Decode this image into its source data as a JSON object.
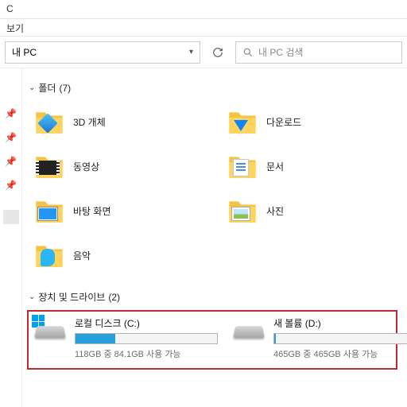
{
  "window": {
    "title": "C"
  },
  "menu": {
    "view": "보기"
  },
  "address": {
    "location": "내 PC"
  },
  "search": {
    "placeholder": "내 PC 검색"
  },
  "groups": {
    "folders": {
      "label": "폴더",
      "count": "(7)"
    },
    "devices": {
      "label": "장치 및 드라이브",
      "count": "(2)"
    }
  },
  "folders": [
    {
      "name": "3D 개체",
      "icon": "cube"
    },
    {
      "name": "다운로드",
      "icon": "download"
    },
    {
      "name": "동영상",
      "icon": "film"
    },
    {
      "name": "문서",
      "icon": "doc"
    },
    {
      "name": "바탕 화면",
      "icon": "desk"
    },
    {
      "name": "사진",
      "icon": "photo"
    },
    {
      "name": "음악",
      "icon": "note"
    }
  ],
  "drives": [
    {
      "name": "로컬 디스크 (C:)",
      "sub": "118GB 중 84.1GB 사용 가능",
      "fill": 28,
      "os": true
    },
    {
      "name": "새 볼륨 (D:)",
      "sub": "465GB 중 465GB 사용 가능",
      "fill": 1,
      "os": false
    }
  ]
}
